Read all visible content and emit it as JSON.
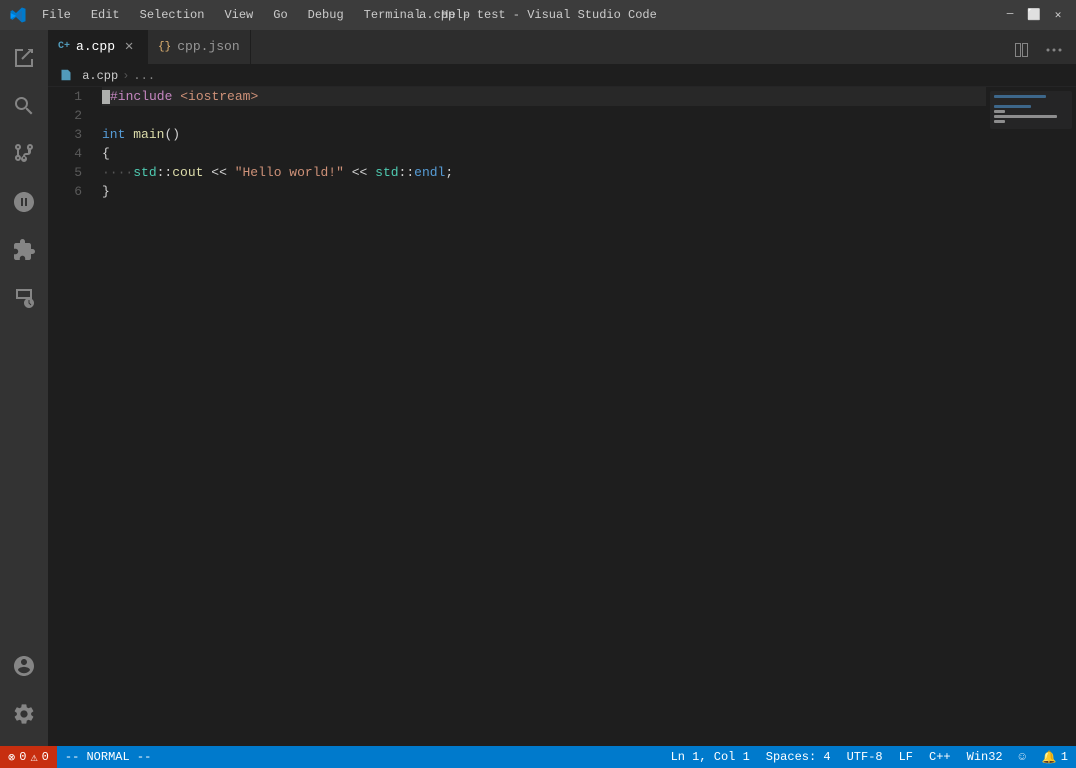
{
  "window": {
    "title": "a.cpp - test - Visual Studio Code",
    "menu": [
      "File",
      "Edit",
      "Selection",
      "View",
      "Go",
      "Debug",
      "Terminal",
      "Help"
    ]
  },
  "tabs": [
    {
      "id": "a-cpp",
      "label": "a.cpp",
      "icon": "C+",
      "active": true,
      "modified": false
    },
    {
      "id": "cpp-json",
      "label": "cpp.json",
      "icon": "{}",
      "active": false,
      "modified": false
    }
  ],
  "breadcrumb": {
    "parts": [
      "a.cpp",
      "..."
    ]
  },
  "editor": {
    "lines": [
      {
        "num": "1",
        "tokens": [
          {
            "t": "cursor"
          },
          {
            "t": "kw2",
            "v": "#include"
          },
          {
            "t": "sp",
            "v": " "
          },
          {
            "t": "include-file",
            "v": "<iostream>"
          }
        ]
      },
      {
        "num": "2",
        "tokens": []
      },
      {
        "num": "3",
        "tokens": [
          {
            "t": "kw",
            "v": "int"
          },
          {
            "t": "sp",
            "v": " "
          },
          {
            "t": "fn",
            "v": "main"
          },
          {
            "t": "punct",
            "v": "()"
          }
        ]
      },
      {
        "num": "4",
        "tokens": [
          {
            "t": "punct",
            "v": "{"
          }
        ]
      },
      {
        "num": "5",
        "tokens": [
          {
            "t": "indent",
            "v": "····"
          },
          {
            "t": "ns",
            "v": "std"
          },
          {
            "t": "op",
            "v": "::"
          },
          {
            "t": "fn",
            "v": "cout"
          },
          {
            "t": "sp",
            "v": " "
          },
          {
            "t": "op",
            "v": "<<"
          },
          {
            "t": "sp",
            "v": " "
          },
          {
            "t": "str",
            "v": "\"Hello world!\""
          },
          {
            "t": "sp",
            "v": " "
          },
          {
            "t": "op",
            "v": "<<"
          },
          {
            "t": "sp",
            "v": " "
          },
          {
            "t": "ns",
            "v": "std"
          },
          {
            "t": "op",
            "v": "::"
          },
          {
            "t": "kw",
            "v": "endl"
          },
          {
            "t": "punct",
            "v": ";"
          }
        ]
      },
      {
        "num": "6",
        "tokens": [
          {
            "t": "punct",
            "v": "}"
          }
        ]
      }
    ]
  },
  "statusbar": {
    "left": {
      "error_icon": "⊗",
      "errors": "0",
      "warn_icon": "⚠",
      "warnings": "0",
      "vim_mode": "-- NORMAL --"
    },
    "right": {
      "position": "Ln 1, Col 1",
      "spaces": "Spaces: 4",
      "encoding": "UTF-8",
      "line_ending": "LF",
      "language": "C++",
      "platform": "Win32",
      "feedback_icon": "☺",
      "bell_icon": "🔔",
      "count": "1"
    }
  },
  "activity": {
    "items": [
      {
        "id": "explorer",
        "label": "Explorer",
        "active": false
      },
      {
        "id": "search",
        "label": "Search",
        "active": false
      },
      {
        "id": "source-control",
        "label": "Source Control",
        "active": false
      },
      {
        "id": "debug",
        "label": "Debug",
        "active": false
      },
      {
        "id": "extensions",
        "label": "Extensions",
        "active": false
      },
      {
        "id": "remote",
        "label": "Remote Explorer",
        "active": false
      }
    ],
    "bottom": [
      {
        "id": "accounts",
        "label": "Accounts"
      },
      {
        "id": "settings",
        "label": "Settings"
      }
    ]
  }
}
